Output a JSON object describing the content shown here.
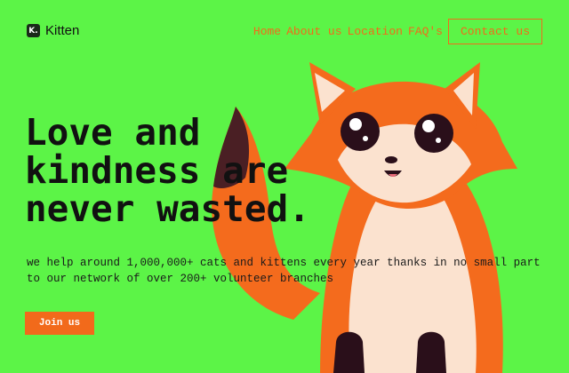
{
  "brand": {
    "mark": "K.",
    "name": "Kitten"
  },
  "nav": {
    "items": [
      "Home",
      "About us",
      "Location",
      "FAQ's"
    ],
    "contact_label": "Contact us"
  },
  "hero": {
    "title_lines": [
      "Love and",
      "kindness are",
      "never wasted."
    ],
    "subtitle": "we help around 1,000,000+ cats and kittens every year thanks in no small part to our network of over 200+ volunteer branches",
    "cta_label": "Join us"
  },
  "colors": {
    "background": "#5cf447",
    "accent": "#f26a1b",
    "text": "#111111"
  },
  "illustration": {
    "icon": "fox-illustration"
  }
}
